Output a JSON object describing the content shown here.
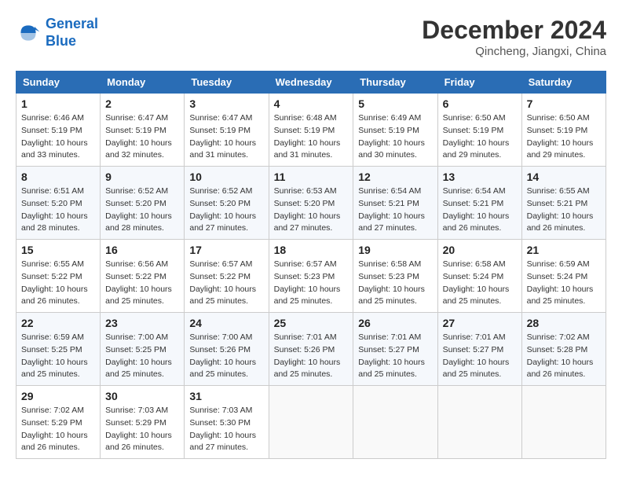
{
  "header": {
    "logo_line1": "General",
    "logo_line2": "Blue",
    "month_title": "December 2024",
    "location": "Qincheng, Jiangxi, China"
  },
  "weekdays": [
    "Sunday",
    "Monday",
    "Tuesday",
    "Wednesday",
    "Thursday",
    "Friday",
    "Saturday"
  ],
  "weeks": [
    [
      {
        "day": "1",
        "info": "Sunrise: 6:46 AM\nSunset: 5:19 PM\nDaylight: 10 hours\nand 33 minutes."
      },
      {
        "day": "2",
        "info": "Sunrise: 6:47 AM\nSunset: 5:19 PM\nDaylight: 10 hours\nand 32 minutes."
      },
      {
        "day": "3",
        "info": "Sunrise: 6:47 AM\nSunset: 5:19 PM\nDaylight: 10 hours\nand 31 minutes."
      },
      {
        "day": "4",
        "info": "Sunrise: 6:48 AM\nSunset: 5:19 PM\nDaylight: 10 hours\nand 31 minutes."
      },
      {
        "day": "5",
        "info": "Sunrise: 6:49 AM\nSunset: 5:19 PM\nDaylight: 10 hours\nand 30 minutes."
      },
      {
        "day": "6",
        "info": "Sunrise: 6:50 AM\nSunset: 5:19 PM\nDaylight: 10 hours\nand 29 minutes."
      },
      {
        "day": "7",
        "info": "Sunrise: 6:50 AM\nSunset: 5:19 PM\nDaylight: 10 hours\nand 29 minutes."
      }
    ],
    [
      {
        "day": "8",
        "info": "Sunrise: 6:51 AM\nSunset: 5:20 PM\nDaylight: 10 hours\nand 28 minutes."
      },
      {
        "day": "9",
        "info": "Sunrise: 6:52 AM\nSunset: 5:20 PM\nDaylight: 10 hours\nand 28 minutes."
      },
      {
        "day": "10",
        "info": "Sunrise: 6:52 AM\nSunset: 5:20 PM\nDaylight: 10 hours\nand 27 minutes."
      },
      {
        "day": "11",
        "info": "Sunrise: 6:53 AM\nSunset: 5:20 PM\nDaylight: 10 hours\nand 27 minutes."
      },
      {
        "day": "12",
        "info": "Sunrise: 6:54 AM\nSunset: 5:21 PM\nDaylight: 10 hours\nand 27 minutes."
      },
      {
        "day": "13",
        "info": "Sunrise: 6:54 AM\nSunset: 5:21 PM\nDaylight: 10 hours\nand 26 minutes."
      },
      {
        "day": "14",
        "info": "Sunrise: 6:55 AM\nSunset: 5:21 PM\nDaylight: 10 hours\nand 26 minutes."
      }
    ],
    [
      {
        "day": "15",
        "info": "Sunrise: 6:55 AM\nSunset: 5:22 PM\nDaylight: 10 hours\nand 26 minutes."
      },
      {
        "day": "16",
        "info": "Sunrise: 6:56 AM\nSunset: 5:22 PM\nDaylight: 10 hours\nand 25 minutes."
      },
      {
        "day": "17",
        "info": "Sunrise: 6:57 AM\nSunset: 5:22 PM\nDaylight: 10 hours\nand 25 minutes."
      },
      {
        "day": "18",
        "info": "Sunrise: 6:57 AM\nSunset: 5:23 PM\nDaylight: 10 hours\nand 25 minutes."
      },
      {
        "day": "19",
        "info": "Sunrise: 6:58 AM\nSunset: 5:23 PM\nDaylight: 10 hours\nand 25 minutes."
      },
      {
        "day": "20",
        "info": "Sunrise: 6:58 AM\nSunset: 5:24 PM\nDaylight: 10 hours\nand 25 minutes."
      },
      {
        "day": "21",
        "info": "Sunrise: 6:59 AM\nSunset: 5:24 PM\nDaylight: 10 hours\nand 25 minutes."
      }
    ],
    [
      {
        "day": "22",
        "info": "Sunrise: 6:59 AM\nSunset: 5:25 PM\nDaylight: 10 hours\nand 25 minutes."
      },
      {
        "day": "23",
        "info": "Sunrise: 7:00 AM\nSunset: 5:25 PM\nDaylight: 10 hours\nand 25 minutes."
      },
      {
        "day": "24",
        "info": "Sunrise: 7:00 AM\nSunset: 5:26 PM\nDaylight: 10 hours\nand 25 minutes."
      },
      {
        "day": "25",
        "info": "Sunrise: 7:01 AM\nSunset: 5:26 PM\nDaylight: 10 hours\nand 25 minutes."
      },
      {
        "day": "26",
        "info": "Sunrise: 7:01 AM\nSunset: 5:27 PM\nDaylight: 10 hours\nand 25 minutes."
      },
      {
        "day": "27",
        "info": "Sunrise: 7:01 AM\nSunset: 5:27 PM\nDaylight: 10 hours\nand 25 minutes."
      },
      {
        "day": "28",
        "info": "Sunrise: 7:02 AM\nSunset: 5:28 PM\nDaylight: 10 hours\nand 26 minutes."
      }
    ],
    [
      {
        "day": "29",
        "info": "Sunrise: 7:02 AM\nSunset: 5:29 PM\nDaylight: 10 hours\nand 26 minutes."
      },
      {
        "day": "30",
        "info": "Sunrise: 7:03 AM\nSunset: 5:29 PM\nDaylight: 10 hours\nand 26 minutes."
      },
      {
        "day": "31",
        "info": "Sunrise: 7:03 AM\nSunset: 5:30 PM\nDaylight: 10 hours\nand 27 minutes."
      },
      {
        "day": "",
        "info": ""
      },
      {
        "day": "",
        "info": ""
      },
      {
        "day": "",
        "info": ""
      },
      {
        "day": "",
        "info": ""
      }
    ]
  ]
}
